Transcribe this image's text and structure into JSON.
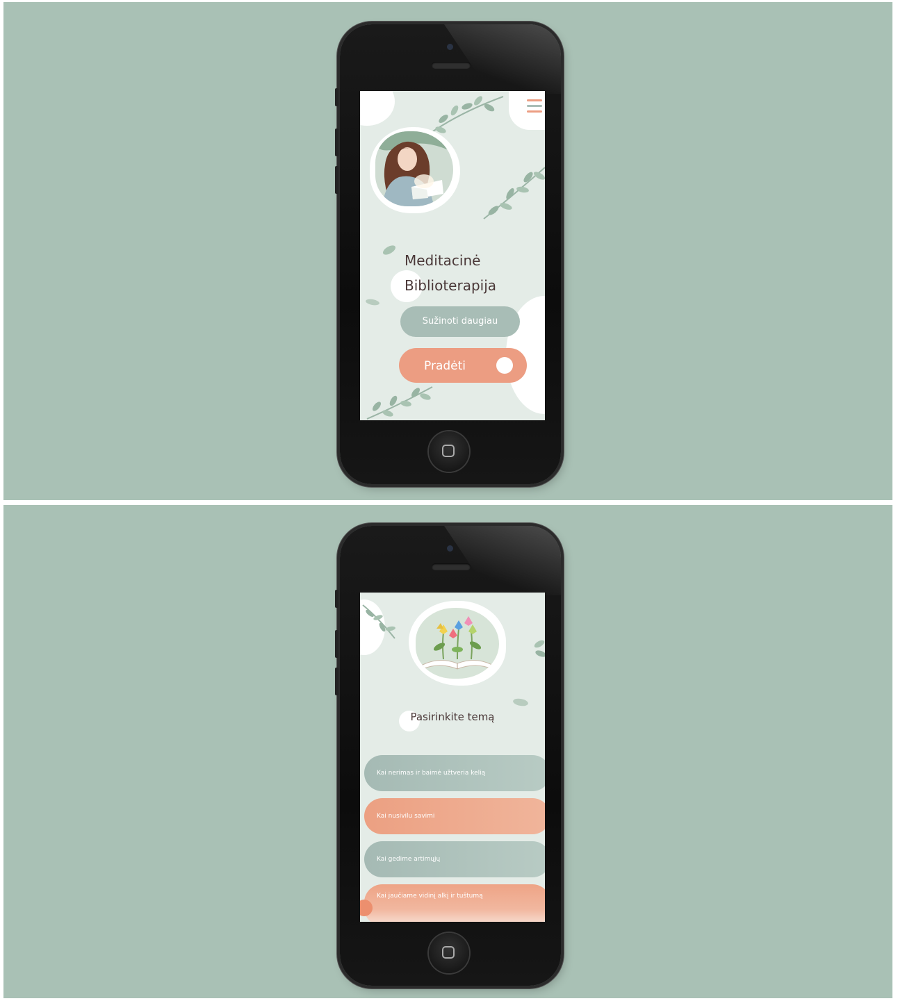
{
  "colors": {
    "backdrop": "#a9c1b5",
    "screen_bg": "#e4ece7",
    "accent_peach": "#ec9d82",
    "accent_green": "#a8bdb6",
    "title_text": "#4a3838",
    "menu_lines": [
      "#ec9d82",
      "#a8bdb6",
      "#ec9d82"
    ]
  },
  "screen1": {
    "title_line1": "Meditacinė",
    "title_line2": "Biblioterapija",
    "learn_more_label": "Sužinoti daugiau",
    "start_label": "Pradėti",
    "menu_icon": "hamburger-icon",
    "illustration": "woman-reading-book-illustration"
  },
  "screen2": {
    "heading": "Pasirinkite temą",
    "illustration": "open-book-with-flowers-illustration",
    "topics": [
      {
        "label": "Kai nerimas ir baimė užtveria kelią",
        "color": "green"
      },
      {
        "label": "Kai nusivilu savimi",
        "color": "peach"
      },
      {
        "label": "Kai gedime artimųjų",
        "color": "green"
      },
      {
        "label": "Kai jaučiame vidinį alkį ir tuštumą",
        "color": "peach"
      }
    ]
  }
}
